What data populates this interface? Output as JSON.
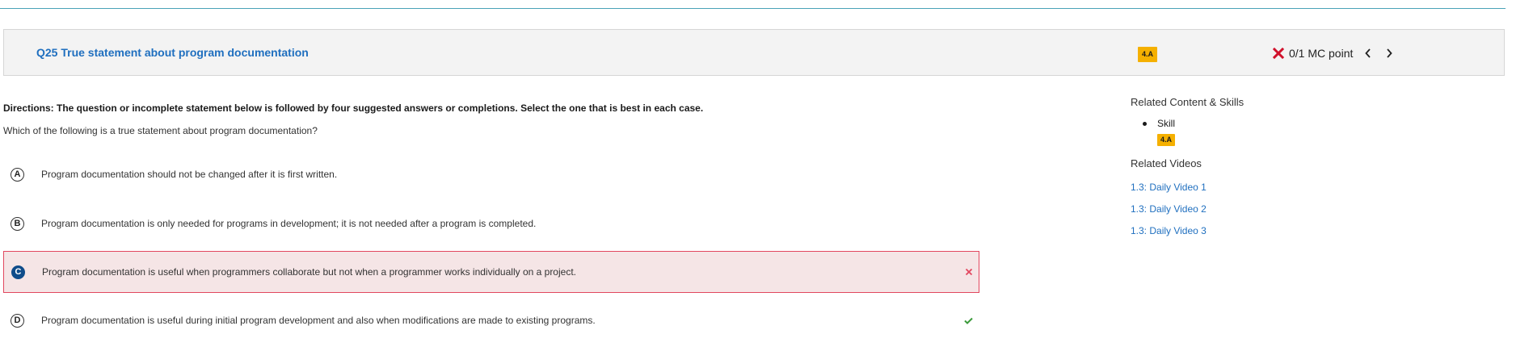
{
  "question": {
    "title": "Q25 True statement about program documentation",
    "skill_badge": "4.A",
    "score_text": "0/1 MC point"
  },
  "directions": "Directions: The question or incomplete statement below is followed by four suggested answers or completions. Select the one that is best in each case.",
  "prompt": "Which of the following is a true statement about program documentation?",
  "options": [
    {
      "letter": "A",
      "text": "Program documentation should not be changed after it is first written."
    },
    {
      "letter": "B",
      "text": "Program documentation is only needed for programs in development; it is not needed after a program is completed."
    },
    {
      "letter": "C",
      "text": "Program documentation is useful when programmers collaborate but not when a programmer works individually on a project.",
      "state": "selected-incorrect"
    },
    {
      "letter": "D",
      "text": "Program documentation is useful during initial program development and also when modifications are made to existing programs.",
      "state": "correct"
    }
  ],
  "sidebar": {
    "related_heading": "Related Content & Skills",
    "skill_label": "Skill",
    "skill_badge": "4.A",
    "videos_heading": "Related Videos",
    "videos": [
      "1.3: Daily Video 1",
      "1.3: Daily Video 2",
      "1.3: Daily Video 3"
    ]
  },
  "colors": {
    "accent": "#1f6fbf",
    "badge": "#f5b000",
    "incorrect": "#e2475f",
    "incorrect_bg": "#f5e5e6",
    "correct": "#3a9a3a",
    "selected_letter": "#0f4c8a"
  },
  "icons": {
    "score": "x-icon",
    "prev": "chevron-left-icon",
    "next": "chevron-right-icon",
    "incorrect_mark": "x-mark-icon",
    "correct_mark": "checkmark-icon"
  }
}
